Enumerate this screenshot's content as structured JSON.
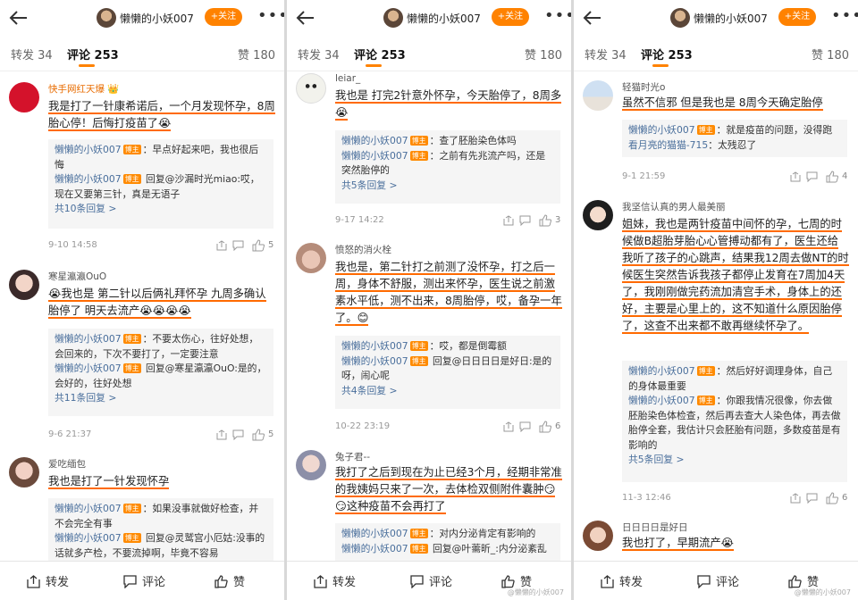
{
  "panels": [
    {
      "header": {
        "username": "懒懒的小妖007",
        "follow_label": "+关注"
      },
      "tabs": {
        "repost": "转发 34",
        "comment": "评论 253",
        "like": "赞 180"
      },
      "comments": [
        {
          "name": "快手网红天爆 👑",
          "text": "我是打了一针康希诺后，一个月发现怀孕，8周胎心停！后悔打疫苗了😭",
          "replies": [
            {
              "name": "懒懒的小妖007",
              "tag": "博主",
              "text": "：早点好起来吧，我也很后悔"
            },
            {
              "name": "懒懒的小妖007",
              "tag": "博主",
              "text": " 回复@沙漏时光miao:哎，现在又要第三针，真是无语子"
            }
          ],
          "more": "共10条回复 >",
          "time": "9-10 14:58",
          "likes": "5"
        },
        {
          "name": "寒星瀛瀛OuO",
          "text": "😭我也是 第二针以后俩礼拜怀孕 九周多确认胎停了 明天去流产😭😭😭😭",
          "replies": [
            {
              "name": "懒懒的小妖007",
              "tag": "博主",
              "text": "：不要太伤心，往好处想，会回来的，下次不要打了，一定要注意"
            },
            {
              "name": "懒懒的小妖007",
              "tag": "博主",
              "text": " 回复@寒星瀛瀛OuO:是的，会好的，往好处想"
            }
          ],
          "more": "共11条回复 >",
          "time": "9-6 21:37",
          "likes": "5"
        },
        {
          "name": "爱吃缅包",
          "text": "我也是打了一针发现怀孕",
          "replies": [
            {
              "name": "懒懒的小妖007",
              "tag": "博主",
              "text": "：如果没事就做好检查，并不会完全有事"
            },
            {
              "name": "懒懒的小妖007",
              "tag": "博主",
              "text": " 回复@灵鹫宫小厄姑:没事的话就多产检，不要流掉啊，毕竟不容易"
            }
          ]
        }
      ]
    },
    {
      "header": {
        "username": "懒懒的小妖007",
        "follow_label": "+关注"
      },
      "tabs": {
        "repost": "转发 34",
        "comment": "评论 253",
        "like": "赞 180"
      },
      "comments": [
        {
          "name": "leiar_",
          "text": "我也是 打完2针意外怀孕，今天胎停了，8周多😭",
          "replies": [
            {
              "name": "懒懒的小妖007",
              "tag": "博主",
              "text": "：查了胚胎染色体吗"
            },
            {
              "name": "懒懒的小妖007",
              "tag": "博主",
              "text": "：之前有先兆流产吗，还是突然胎停的"
            }
          ],
          "more": "共5条回复 >",
          "time": "9-17 14:22",
          "likes": "3"
        },
        {
          "name": "愤怒的消火栓",
          "text": "我也是，第二针打之前测了没怀孕，打之后一周，身体不舒服，测出来怀孕，医生说之前激素水平低，测不出来，8周胎停，哎，备孕一年了。😊",
          "replies": [
            {
              "name": "懒懒的小妖007",
              "tag": "博主",
              "text": "：哎，都是倒霉额"
            },
            {
              "name": "懒懒的小妖007",
              "tag": "博主",
              "text": " 回复@日日日日是好日:是的呀，闹心呢"
            }
          ],
          "more": "共4条回复 >",
          "time": "10-22 23:19",
          "likes": "6"
        },
        {
          "name": "兔子君--",
          "text": "我打了之后到现在为止已经3个月，经期非常准的我姨妈只来了一次，去体检双侧附件囊肿😏😏这种疫苗不会再打了",
          "replies": [
            {
              "name": "懒懒的小妖007",
              "tag": "博主",
              "text": "：对内分泌肯定有影响的"
            },
            {
              "name": "懒懒的小妖007",
              "tag": "博主",
              "text": " 回复@叶薷昕_:内分泌紊乱"
            }
          ]
        }
      ]
    },
    {
      "header": {
        "username": "懒懒的小妖007",
        "follow_label": "+关注"
      },
      "tabs": {
        "repost": "转发 34",
        "comment": "评论 253",
        "like": "赞 180"
      },
      "comments": [
        {
          "name": "轻猫时光o",
          "text": "虽然不信邪 但是我也是 8周今天确定胎停",
          "replies": [
            {
              "name": "懒懒的小妖007",
              "tag": "博主",
              "text": "：就是疫苗的问题，没得跑"
            },
            {
              "name": "看月亮的猫猫-715",
              "tag": "",
              "text": "：太残忍了"
            }
          ],
          "more": "",
          "time": "9-1 21:59",
          "likes": "4"
        },
        {
          "name": "我坚信认真的男人最美丽",
          "text": "姐妹，我也是两针疫苗中间怀的孕，七周的时候做B超胎芽胎心心管搏动都有了，医生还给我听了孩子的心跳声，结果我12周去做NT的时候医生突然告诉我孩子都停止发育在7周加4天了，我刚刚做完药流加清宫手术，身体上的还好，主要是心里上的，这不知道什么原因胎停了，这查不出来都不敢再继续怀孕了。",
          "replies": [
            {
              "name": "懒懒的小妖007",
              "tag": "博主",
              "text": "：然后好好调理身体，自己的身体最重要"
            },
            {
              "name": "懒懒的小妖007",
              "tag": "博主",
              "text": "：你跟我情况很像，你去做胚胎染色体检查，然后再去查大人染色体，再去做胎停全套，我估计只会胚胎有问题，多数疫苗是有影响的"
            }
          ],
          "more": "共5条回复 >",
          "time": "11-3 12:46",
          "likes": "6"
        },
        {
          "name": "日日日日是好日",
          "text": "我也打了，早期流产😭",
          "replies": []
        }
      ]
    }
  ],
  "bottom_bar": {
    "repost": "转发",
    "comment": "评论",
    "like": "赞"
  },
  "watermark": "@懒懒的小妖007"
}
